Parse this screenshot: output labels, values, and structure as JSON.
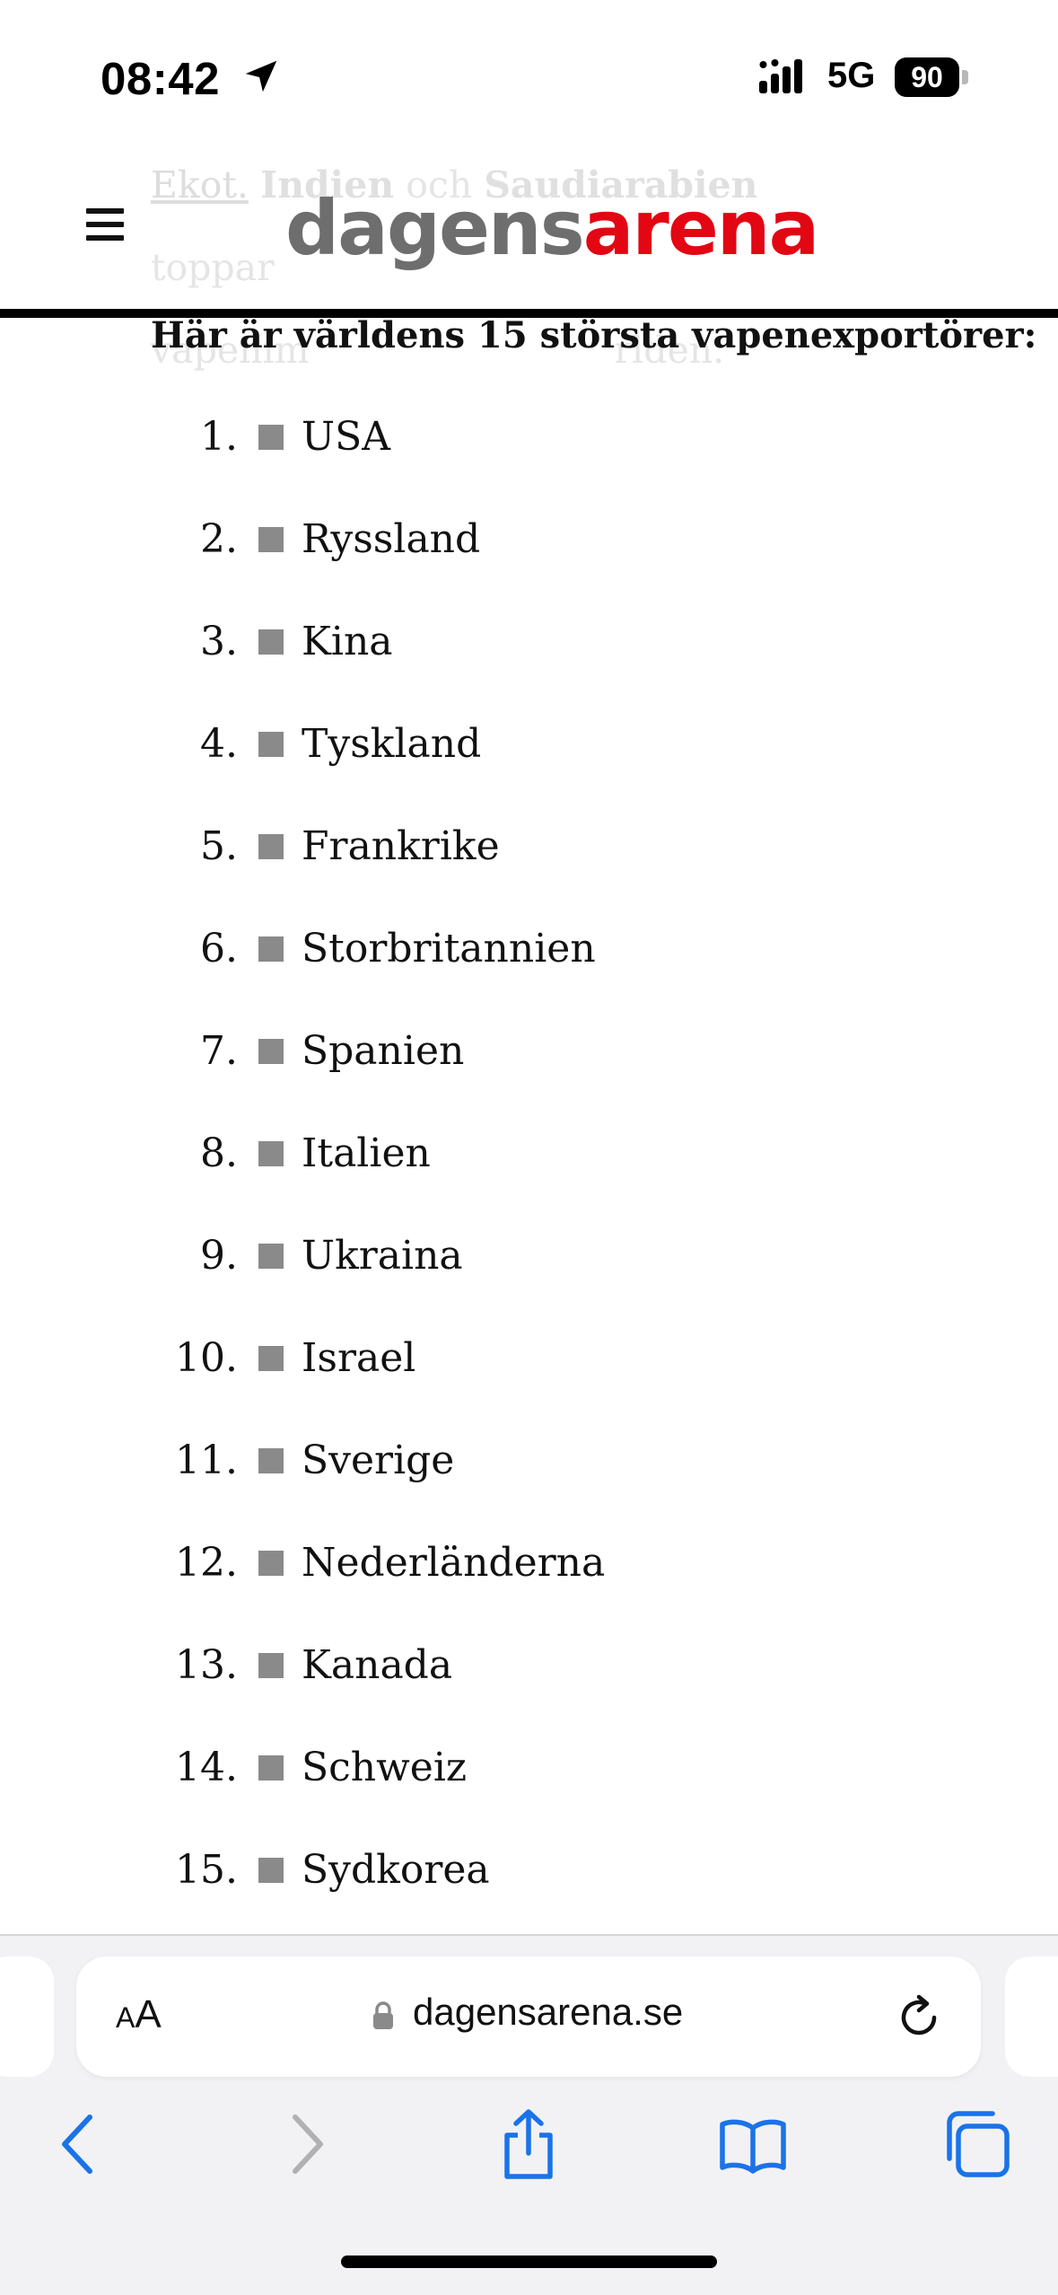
{
  "status_bar": {
    "time": "08:42",
    "network": "5G",
    "battery": "90"
  },
  "background_text": {
    "line1_link": "Ekot.",
    "line1_bold1": "Indien",
    "line1_mid": "och",
    "line1_bold2": "Saudiarabien",
    "line1_end": "toppar",
    "line2_start": "vapenim",
    "line2_end": "rlden."
  },
  "header": {
    "logo_part1": "dagens",
    "logo_part2": "arena"
  },
  "article": {
    "heading": "Här är världens 15 största vapenexportörer:",
    "items": [
      {
        "num": "1.",
        "name": "USA"
      },
      {
        "num": "2.",
        "name": "Ryssland"
      },
      {
        "num": "3.",
        "name": "Kina"
      },
      {
        "num": "4.",
        "name": "Tyskland"
      },
      {
        "num": "5.",
        "name": "Frankrike"
      },
      {
        "num": "6.",
        "name": "Storbritannien"
      },
      {
        "num": "7.",
        "name": "Spanien"
      },
      {
        "num": "8.",
        "name": "Italien"
      },
      {
        "num": "9.",
        "name": "Ukraina"
      },
      {
        "num": "10.",
        "name": "Israel"
      },
      {
        "num": "11.",
        "name": "Sverige"
      },
      {
        "num": "12.",
        "name": "Nederländerna"
      },
      {
        "num": "13.",
        "name": "Kanada"
      },
      {
        "num": "14.",
        "name": "Schweiz"
      },
      {
        "num": "15.",
        "name": "Sydkorea"
      }
    ]
  },
  "browser": {
    "aa_small": "A",
    "aa_large": "A",
    "url": "dagensarena.se"
  },
  "colors": {
    "brand_red": "#e30613",
    "brand_gray": "#6e6e6e",
    "ios_blue": "#1a73e8"
  }
}
